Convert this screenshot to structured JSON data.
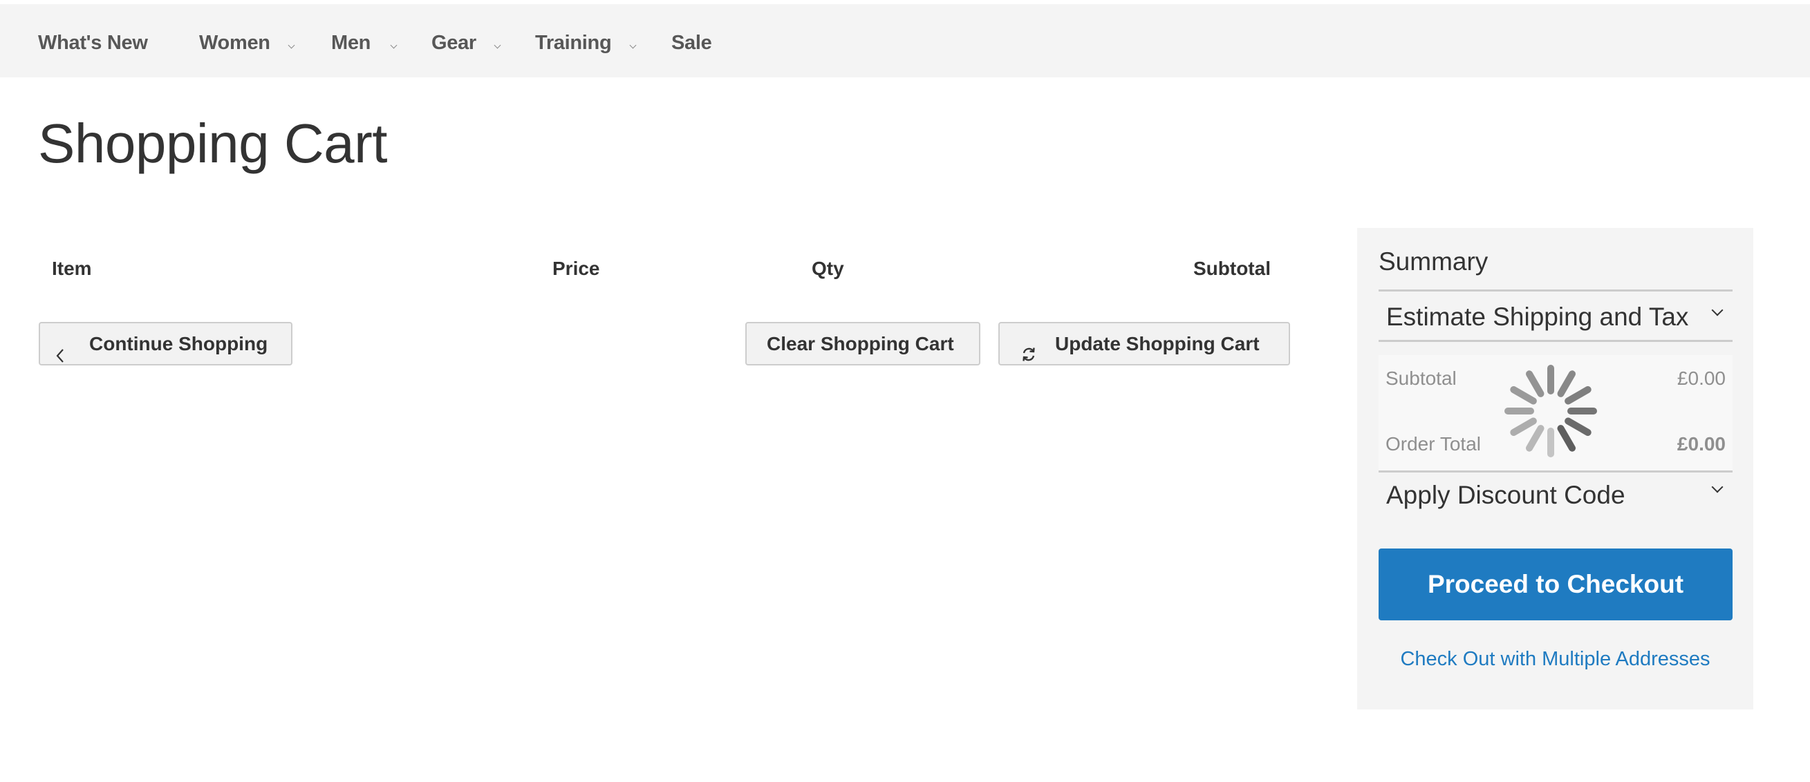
{
  "nav": {
    "items": [
      {
        "label": "What's New",
        "has_submenu": false
      },
      {
        "label": "Women",
        "has_submenu": true
      },
      {
        "label": "Men",
        "has_submenu": true
      },
      {
        "label": "Gear",
        "has_submenu": true
      },
      {
        "label": "Training",
        "has_submenu": true
      },
      {
        "label": "Sale",
        "has_submenu": false
      }
    ]
  },
  "page": {
    "title": "Shopping Cart"
  },
  "cart_table": {
    "columns": [
      "Item",
      "Price",
      "Qty",
      "Subtotal"
    ]
  },
  "actions": {
    "continue_shopping": "Continue Shopping",
    "clear_cart": "Clear Shopping Cart",
    "update_cart": "Update Shopping Cart"
  },
  "summary": {
    "title": "Summary",
    "estimate_shipping": "Estimate Shipping and Tax",
    "totals": {
      "subtotal_label": "Subtotal",
      "subtotal_value": "£0.00",
      "order_total_label": "Order Total",
      "order_total_value": "£0.00",
      "loading": true
    },
    "discount": "Apply Discount Code",
    "checkout_button": "Proceed to Checkout",
    "multi_address_link": "Check Out with Multiple Addresses"
  },
  "colors": {
    "accent": "#1f7bc1",
    "nav_bg": "#f4f4f4",
    "summary_bg": "#f4f4f4",
    "button_bg": "#f2f2f2",
    "text": "#333333",
    "muted_text": "#8f8f8f"
  }
}
